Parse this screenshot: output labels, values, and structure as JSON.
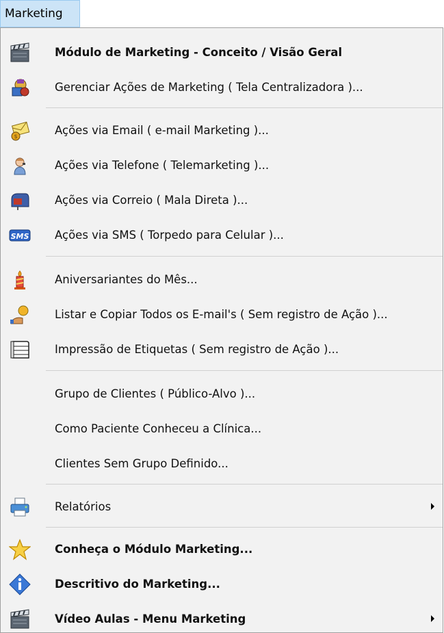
{
  "menubar": {
    "title": "Marketing"
  },
  "menu": {
    "items": [
      {
        "label": "Módulo de Marketing - Conceito / Visão Geral",
        "bold": true,
        "icon": "clapperboard-icon"
      },
      {
        "label": "Gerenciar Ações de Marketing ( Tela Centralizadora )...",
        "bold": false,
        "icon": "marketing-manager-icon"
      },
      {
        "label": "Ações via Email ( e-mail Marketing )...",
        "bold": false,
        "icon": "email-marketing-icon"
      },
      {
        "label": "Ações via Telefone ( Telemarketing )...",
        "bold": false,
        "icon": "telephone-operator-icon"
      },
      {
        "label": "Ações via Correio ( Mala Direta )...",
        "bold": false,
        "icon": "mailbox-icon"
      },
      {
        "label": "Ações via SMS ( Torpedo para Celular )...",
        "bold": false,
        "icon": "sms-icon"
      },
      {
        "label": "Aniversariantes do Mês...",
        "bold": false,
        "icon": "birthday-candle-icon"
      },
      {
        "label": "Listar e Copiar Todos os E-mail's ( Sem registro de Ação )...",
        "bold": false,
        "icon": "email-list-icon"
      },
      {
        "label": "Impressão de Etiquetas ( Sem registro de Ação )...",
        "bold": false,
        "icon": "labels-print-icon"
      },
      {
        "label": "Grupo de Clientes ( Público-Alvo )...",
        "bold": false,
        "icon": ""
      },
      {
        "label": "Como Paciente Conheceu a Clínica...",
        "bold": false,
        "icon": ""
      },
      {
        "label": "Clientes Sem Grupo Definido...",
        "bold": false,
        "icon": ""
      },
      {
        "label": "Relatórios",
        "bold": false,
        "icon": "printer-icon",
        "submenu": true
      },
      {
        "label": "Conheça o Módulo Marketing...",
        "bold": true,
        "icon": "star-icon"
      },
      {
        "label": "Descritivo do Marketing...",
        "bold": true,
        "icon": "info-icon"
      },
      {
        "label": "Vídeo Aulas - Menu Marketing",
        "bold": true,
        "icon": "clapperboard-icon",
        "submenu": true
      }
    ]
  },
  "colors": {
    "menubar_highlight": "#cce4f7",
    "menu_background": "#f2f2f2",
    "separator": "#d0d0d0"
  }
}
